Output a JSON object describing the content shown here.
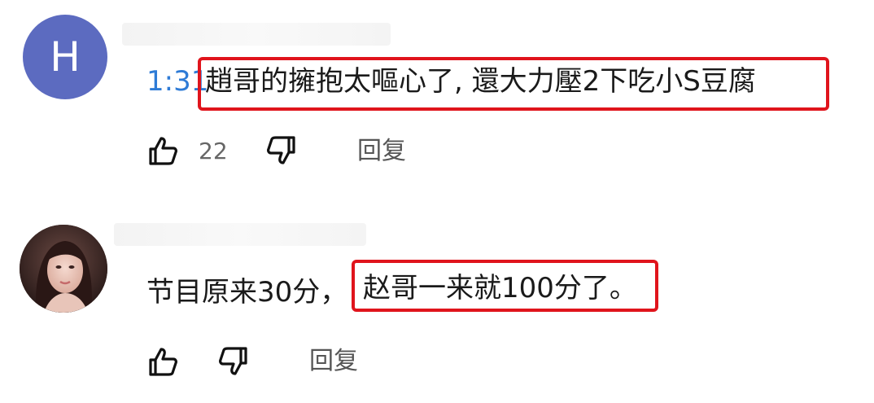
{
  "comments": [
    {
      "avatar_letter": "H",
      "timestamp": "1:31",
      "text": "趙哥的擁抱太嘔心了, 還大力壓2下吃小S豆腐",
      "likes": "22",
      "reply_label": "回复",
      "highlight_color": "#e0141c"
    },
    {
      "avatar_letter": "",
      "text_plain": "节目原来30分，",
      "text_highlight": "赵哥一来就100分了。",
      "likes": "",
      "reply_label": "回复",
      "highlight_color": "#e0141c"
    }
  ],
  "icons": {
    "like": "thumbs-up-icon",
    "dislike": "thumbs-down-icon"
  },
  "colors": {
    "avatar_bg": "#5c6bc0",
    "timestamp": "#2e7bd6",
    "highlight": "#e0141c"
  }
}
